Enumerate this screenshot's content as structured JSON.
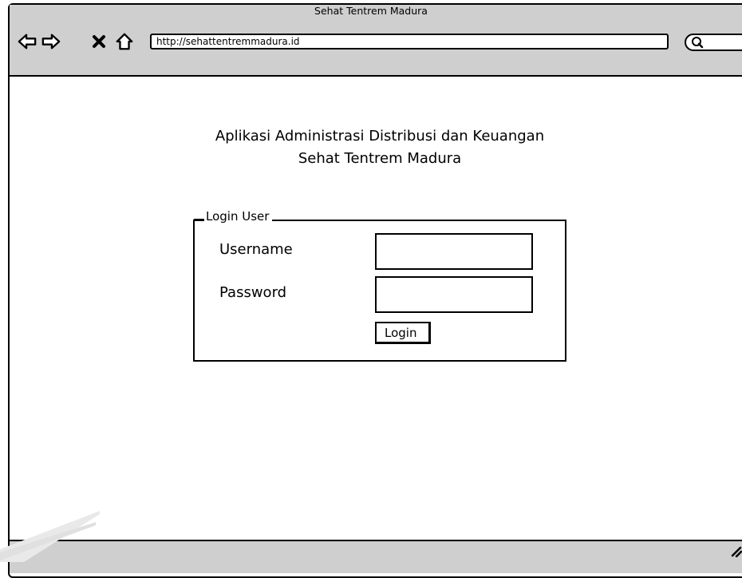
{
  "window": {
    "title": "Sehat Tentrem Madura",
    "url": "http://sehattentremmadura.id"
  },
  "toolbar": {
    "icons": [
      "back-arrow-icon",
      "forward-arrow-icon",
      "close-icon",
      "home-icon",
      "search-icon"
    ]
  },
  "page": {
    "heading_line1": "Aplikasi Administrasi Distribusi dan Keuangan",
    "heading_line2": "Sehat Tentrem Madura"
  },
  "login_form": {
    "legend": "Login User",
    "username_label": "Username",
    "username_value": "",
    "password_label": "Password",
    "password_value": "",
    "submit_label": "Login"
  },
  "colors": {
    "chrome": "#cfcfcf",
    "stroke": "#000000",
    "background": "#ffffff"
  }
}
